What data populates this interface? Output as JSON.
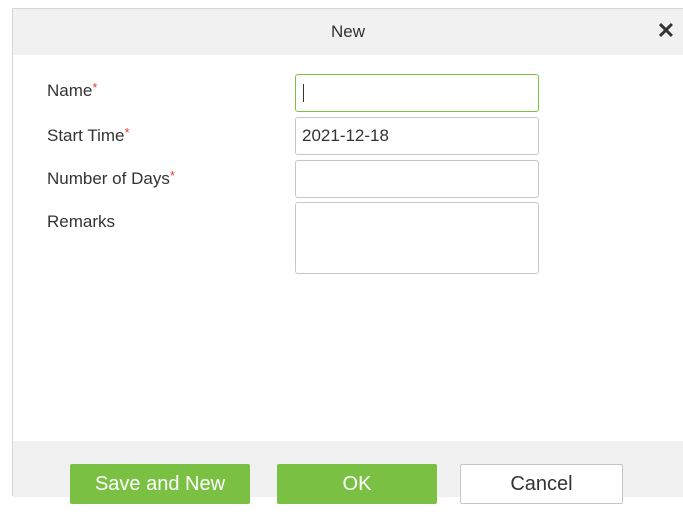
{
  "dialog": {
    "title": "New",
    "close_symbol": "✕"
  },
  "form": {
    "name": {
      "label": "Name",
      "required_mark": "*",
      "value": ""
    },
    "start_time": {
      "label": "Start Time",
      "required_mark": "*",
      "value": "2021-12-18"
    },
    "number_of_days": {
      "label": "Number of Days",
      "required_mark": "*",
      "value": ""
    },
    "remarks": {
      "label": "Remarks",
      "value": ""
    }
  },
  "footer": {
    "save_and_new_label": "Save and New",
    "ok_label": "OK",
    "cancel_label": "Cancel"
  },
  "colors": {
    "accent": "#7ac143",
    "required": "#e23b3b",
    "titlebar_bg": "#f1f1f1"
  }
}
